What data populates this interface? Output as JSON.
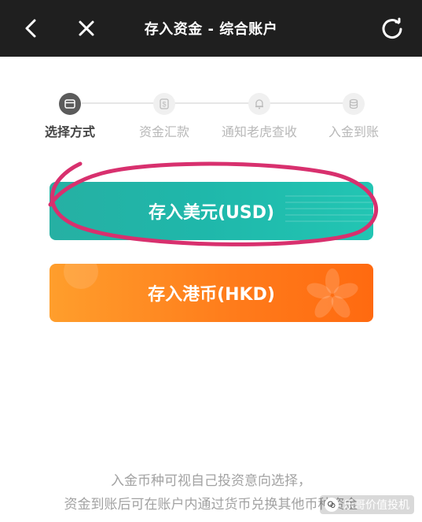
{
  "header": {
    "title": "存入资金 - 综合账户",
    "back_icon": "chevron-left-icon",
    "close_icon": "close-icon",
    "refresh_icon": "refresh-icon"
  },
  "steps": [
    {
      "label": "选择方式",
      "active": true,
      "icon": "card-icon"
    },
    {
      "label": "资金汇款",
      "active": false,
      "icon": "dollar-icon"
    },
    {
      "label": "通知老虎查收",
      "active": false,
      "icon": "bell-icon"
    },
    {
      "label": "入金到账",
      "active": false,
      "icon": "coins-icon"
    }
  ],
  "buttons": {
    "usd_label": "存入美元(USD)",
    "hkd_label": "存入港币(HKD)"
  },
  "hint": {
    "line1": "入金币种可视自己投资意向选择，",
    "line2": "资金到账后可在账户内通过货币兑换其他币种资金"
  },
  "watermark": {
    "text": "乐哥价值投机"
  },
  "colors": {
    "topbar": "#1f1f1f",
    "usd": "#26b0a3",
    "hkd": "#ff7a1a",
    "annotation": "#d8306e"
  }
}
